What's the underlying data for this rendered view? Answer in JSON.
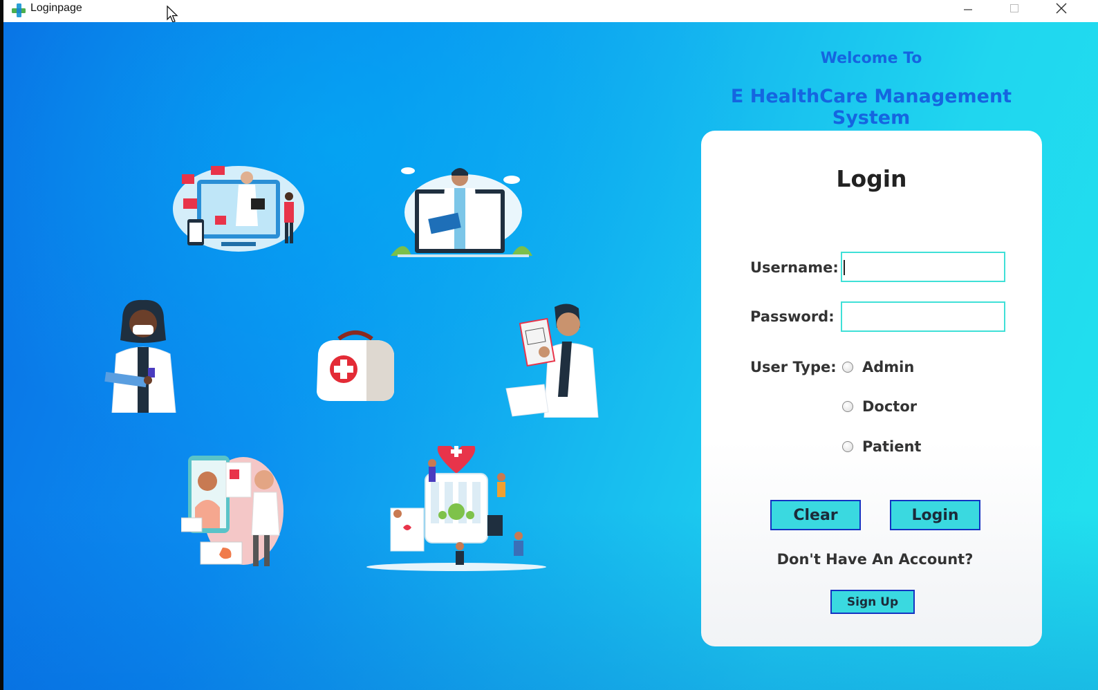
{
  "window": {
    "title": "Loginpage",
    "minimize_glyph": "─",
    "maximize_glyph": "☐",
    "close_glyph": "✕"
  },
  "header": {
    "welcome": "Welcome To",
    "system_title": "E HealthCare Management System"
  },
  "login": {
    "title": "Login",
    "username_label": "Username:",
    "username_value": "",
    "password_label": "Password:",
    "password_value": "",
    "user_type_label": "User Type:",
    "user_types": [
      "Admin",
      "Doctor",
      "Patient"
    ],
    "clear_label": "Clear",
    "login_label": "Login",
    "no_account_text": "Don't Have An Account?",
    "signup_label": "Sign Up"
  },
  "colors": {
    "accent_blue": "#1565e0",
    "button_fill": "#3ad9e0",
    "button_border": "#1433c2",
    "field_border": "#3fe0d7"
  },
  "illustrations": [
    "telemedicine-doctor-screen-icon",
    "doctor-laptop-consult-icon",
    "doctor-with-mask-icon",
    "first-aid-bag-icon",
    "doctor-with-clipboard-icon",
    "patient-phone-consult-icon",
    "hospital-community-icon"
  ]
}
